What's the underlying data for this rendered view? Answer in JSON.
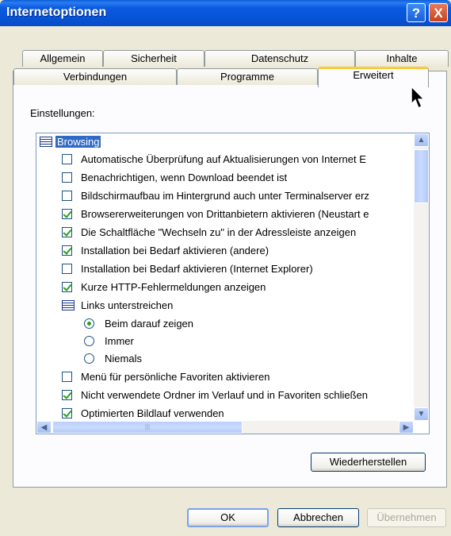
{
  "window": {
    "title": "Internetoptionen",
    "help_glyph": "?",
    "close_glyph": "X"
  },
  "tabs_row_top": [
    "Allgemein",
    "Sicherheit",
    "Datenschutz",
    "Inhalte"
  ],
  "tabs_row_bottom": [
    "Verbindungen",
    "Programme",
    "Erweitert"
  ],
  "active_tab": "Erweitert",
  "settings_label": "Einstellungen:",
  "list": {
    "items": [
      {
        "type": "group",
        "label": "Browsing"
      },
      {
        "type": "checkbox",
        "checked": false,
        "label": "Automatische Überprüfung auf Aktualisierungen von Internet E"
      },
      {
        "type": "checkbox",
        "checked": false,
        "label": "Benachrichtigen, wenn Download beendet ist"
      },
      {
        "type": "checkbox",
        "checked": false,
        "label": "Bildschirmaufbau im Hintergrund auch unter Terminalserver erz"
      },
      {
        "type": "checkbox",
        "checked": true,
        "label": "Browsererweiterungen von Drittanbietern aktivieren (Neustart e"
      },
      {
        "type": "checkbox",
        "checked": true,
        "label": "Die Schaltfläche \"Wechseln zu\" in der Adressleiste anzeigen"
      },
      {
        "type": "checkbox",
        "checked": true,
        "label": "Installation bei Bedarf aktivieren (andere)"
      },
      {
        "type": "checkbox",
        "checked": false,
        "label": "Installation bei Bedarf aktivieren (Internet Explorer)"
      },
      {
        "type": "checkbox",
        "checked": true,
        "label": "Kurze HTTP-Fehlermeldungen anzeigen"
      },
      {
        "type": "subgroup",
        "label": "Links unterstreichen"
      },
      {
        "type": "radio",
        "selected": true,
        "label": "Beim darauf zeigen"
      },
      {
        "type": "radio",
        "selected": false,
        "label": "Immer"
      },
      {
        "type": "radio",
        "selected": false,
        "label": "Niemals"
      },
      {
        "type": "checkbox",
        "checked": false,
        "label": "Menü für persönliche Favoriten aktivieren"
      },
      {
        "type": "checkbox",
        "checked": true,
        "label": "Nicht verwendete Ordner im Verlauf und in Favoriten schließen"
      },
      {
        "type": "checkbox",
        "checked": true,
        "label": "Optimierten Bildlauf verwenden"
      }
    ]
  },
  "buttons": {
    "restore": "Wiederherstellen",
    "ok": "OK",
    "cancel": "Abbrechen",
    "apply": "Übernehmen"
  },
  "icons": {
    "scroll_up": "▲",
    "scroll_down": "▼",
    "scroll_left": "◀",
    "scroll_right": "▶",
    "thumb_grip": "|||"
  }
}
